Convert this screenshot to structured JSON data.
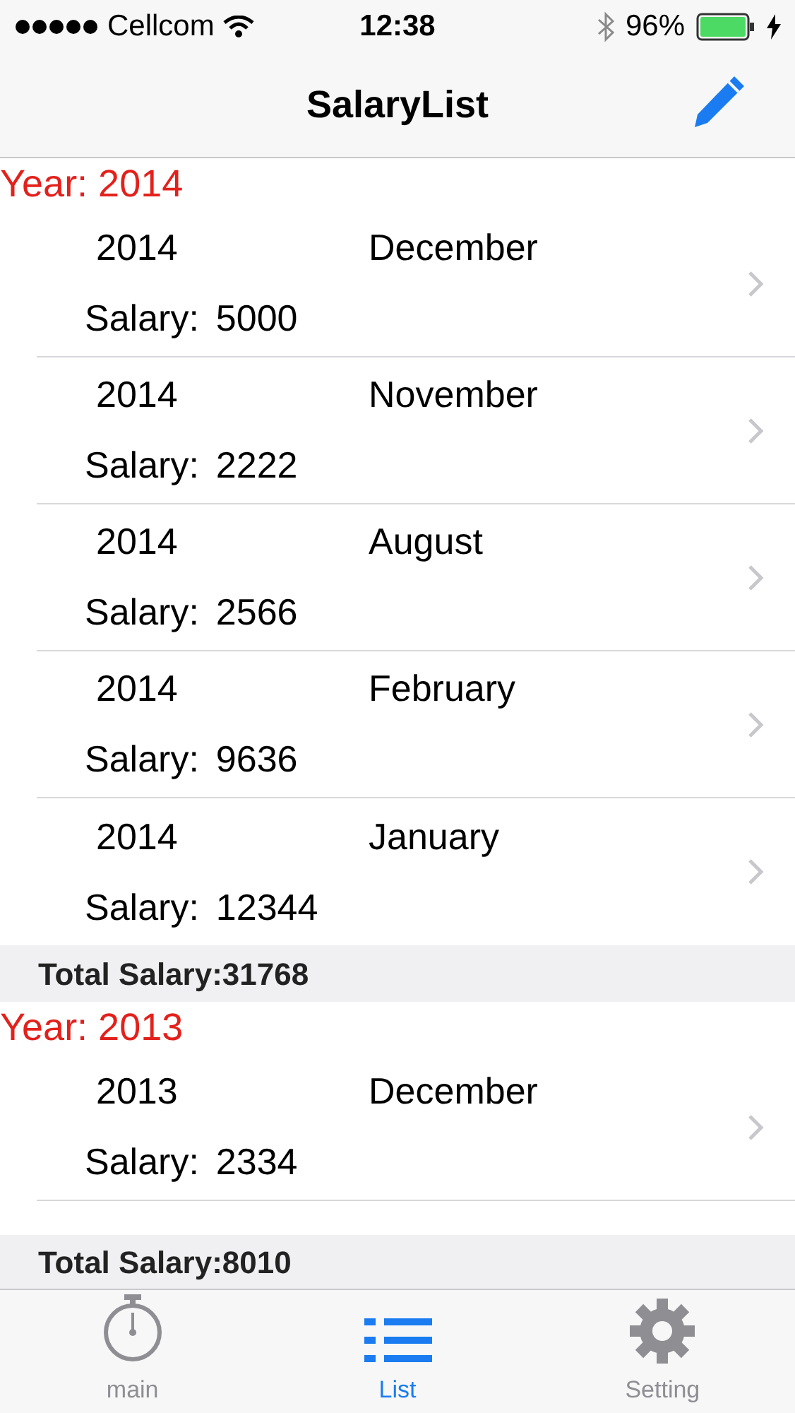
{
  "status_bar": {
    "carrier": "Cellcom",
    "time": "12:38",
    "battery": "96%"
  },
  "nav": {
    "title": "SalaryList"
  },
  "sections": [
    {
      "header": "Year: 2014",
      "total": "Total Salary:31768",
      "rows": [
        {
          "year": "2014",
          "month": "December",
          "salary_label": "Salary:",
          "salary": "5000"
        },
        {
          "year": "2014",
          "month": "November",
          "salary_label": "Salary:",
          "salary": "2222"
        },
        {
          "year": "2014",
          "month": "August",
          "salary_label": "Salary:",
          "salary": "2566"
        },
        {
          "year": "2014",
          "month": "February",
          "salary_label": "Salary:",
          "salary": "9636"
        },
        {
          "year": "2014",
          "month": "January",
          "salary_label": "Salary:",
          "salary": "12344"
        }
      ]
    },
    {
      "header": "Year: 2013",
      "total": "Total Salary:8010",
      "rows": [
        {
          "year": "2013",
          "month": "December",
          "salary_label": "Salary:",
          "salary": "2334"
        }
      ]
    }
  ],
  "tabs": [
    {
      "label": "main",
      "kind": "stopwatch",
      "selected": false
    },
    {
      "label": "List",
      "kind": "list",
      "selected": true
    },
    {
      "label": "Setting",
      "kind": "gear",
      "selected": false
    }
  ]
}
